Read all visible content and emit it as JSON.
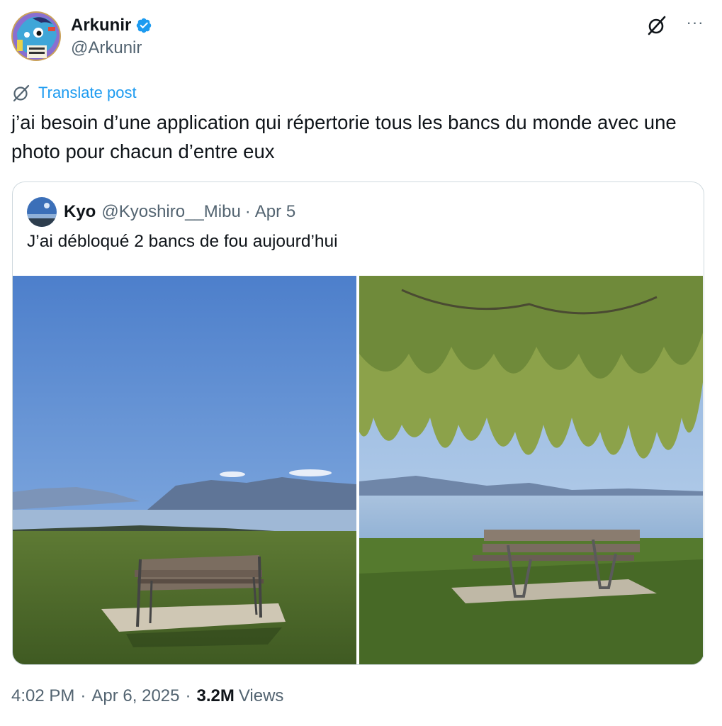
{
  "author": {
    "name": "Arkunir",
    "handle": "@Arkunir",
    "verified_color": "#1d9bf0"
  },
  "actions": {
    "grok_icon": "grok-slash-circle-icon",
    "more_icon": "more-horizontal-icon",
    "more_label": "···"
  },
  "translate": {
    "label": "Translate post",
    "color": "#1d9bf0"
  },
  "tweet": {
    "text": "j’ai besoin d’une application qui répertorie tous les bancs du monde avec une photo pour chacun d’entre eux"
  },
  "quoted": {
    "name": "Kyo",
    "handle": "@Kyoshiro__Mibu",
    "separator": "·",
    "date": "Apr 5",
    "text": "J’ai débloqué 2 bancs de fou aujourd’hui",
    "images": [
      {
        "description_icon": "bench-lake-photo-left"
      },
      {
        "description_icon": "bench-willow-photo-right"
      }
    ]
  },
  "meta": {
    "time": "4:02 PM",
    "separator": "·",
    "date": "Apr 6, 2025",
    "views_count": "3.2M",
    "views_label": "Views"
  }
}
